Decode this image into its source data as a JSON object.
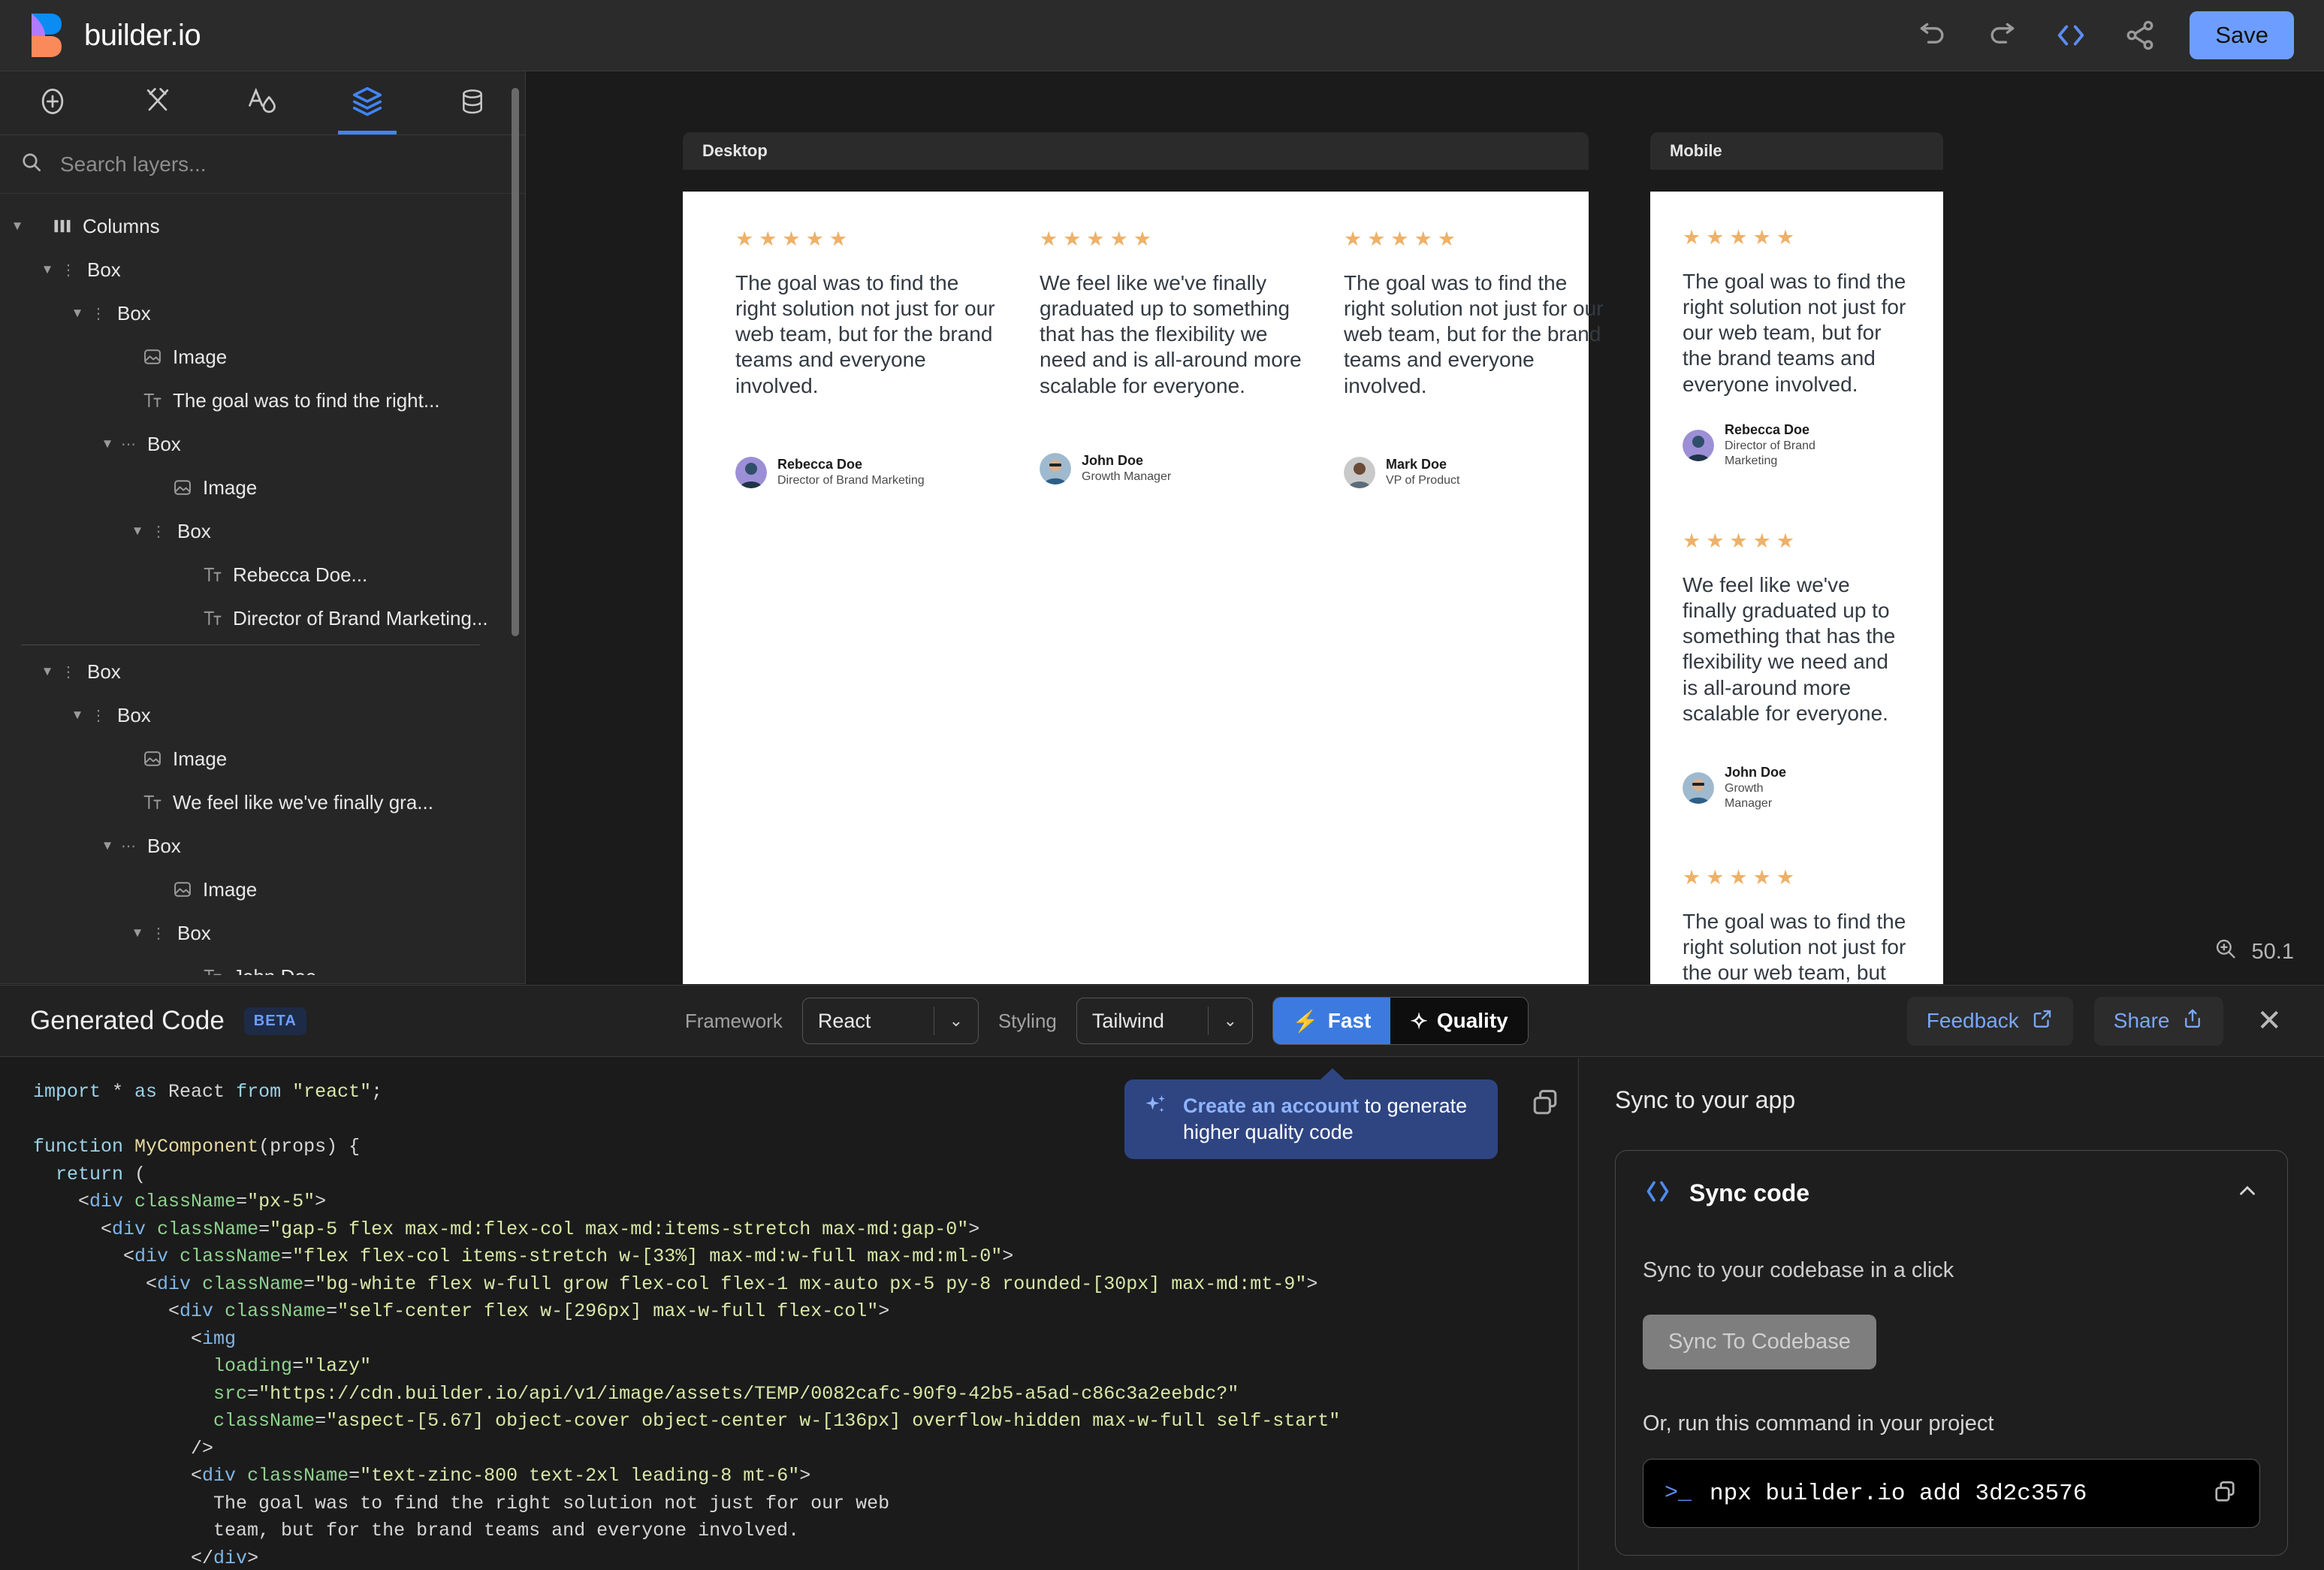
{
  "topbar": {
    "brand": "builder.io",
    "icons": [
      "undo-icon",
      "redo-icon",
      "code-brackets-icon",
      "share-icon"
    ],
    "save_label": "Save"
  },
  "left_panel": {
    "tabs": [
      {
        "name": "insert",
        "icon": "plus-circle-icon",
        "active": false
      },
      {
        "name": "design",
        "icon": "scissors-icon",
        "active": false
      },
      {
        "name": "theme",
        "icon": "text-style-icon",
        "active": false
      },
      {
        "name": "layers",
        "icon": "layers-icon",
        "active": true
      },
      {
        "name": "data",
        "icon": "database-icon",
        "active": false
      }
    ],
    "search_placeholder": "Search layers...",
    "tree": [
      {
        "indent": 0,
        "caret": "▼",
        "handle": "",
        "icon": "columns-icon",
        "label": "Columns"
      },
      {
        "indent": 1,
        "caret": "▼",
        "handle": "⋮",
        "icon": "",
        "label": "Box"
      },
      {
        "indent": 2,
        "caret": "▼",
        "handle": "⋮",
        "icon": "",
        "label": "Box"
      },
      {
        "indent": 3,
        "caret": "",
        "handle": "",
        "icon": "image-icon",
        "label": "Image"
      },
      {
        "indent": 3,
        "caret": "",
        "handle": "",
        "icon": "text-icon",
        "label": "The goal was to find the right..."
      },
      {
        "indent": 3,
        "caret": "▼",
        "handle": "⋯",
        "icon": "",
        "label": "Box"
      },
      {
        "indent": 4,
        "caret": "",
        "handle": "",
        "icon": "image-icon",
        "label": "Image"
      },
      {
        "indent": 4,
        "caret": "▼",
        "handle": "⋮",
        "icon": "",
        "label": "Box"
      },
      {
        "indent": 5,
        "caret": "",
        "handle": "",
        "icon": "text-icon",
        "label": "Rebecca Doe..."
      },
      {
        "indent": 5,
        "caret": "",
        "handle": "",
        "icon": "text-icon",
        "label": "Director of Brand Marketing..."
      },
      {
        "separator": true
      },
      {
        "indent": 1,
        "caret": "▼",
        "handle": "⋮",
        "icon": "",
        "label": "Box"
      },
      {
        "indent": 2,
        "caret": "▼",
        "handle": "⋮",
        "icon": "",
        "label": "Box"
      },
      {
        "indent": 3,
        "caret": "",
        "handle": "",
        "icon": "image-icon",
        "label": "Image"
      },
      {
        "indent": 3,
        "caret": "",
        "handle": "",
        "icon": "text-icon",
        "label": "We feel like we've finally gra..."
      },
      {
        "indent": 3,
        "caret": "▼",
        "handle": "⋯",
        "icon": "",
        "label": "Box"
      },
      {
        "indent": 4,
        "caret": "",
        "handle": "",
        "icon": "image-icon",
        "label": "Image"
      },
      {
        "indent": 4,
        "caret": "▼",
        "handle": "⋮",
        "icon": "",
        "label": "Box"
      },
      {
        "indent": 5,
        "caret": "",
        "handle": "",
        "icon": "text-icon",
        "label": "John Doe..."
      }
    ]
  },
  "canvas": {
    "desktop_label": "Desktop",
    "mobile_label": "Mobile",
    "zoom_value": "50.1",
    "stars": "★★★★★",
    "desktop_cards": [
      {
        "quote": "The goal was to find the right solution not just for our web team, but for the brand teams and everyone involved.",
        "name": "Rebecca Doe",
        "role": "Director of Brand Marketing"
      },
      {
        "quote": "We feel like we've finally graduated up to something that has the flexibility we need and is all-around more scalable for everyone.",
        "name": "John Doe",
        "role": "Growth Manager"
      },
      {
        "quote": "The goal was to find the right solution not just for our web team, but for the brand teams and everyone involved.",
        "name": "Mark Doe",
        "role": "VP of Product"
      }
    ],
    "mobile_cards": [
      {
        "quote": "The goal was to find the right solution not just for our web team, but for the brand teams and everyone involved.",
        "name": "Rebecca Doe",
        "role": "Director of Brand Marketing"
      },
      {
        "quote": "We feel like we've finally graduated up to something that has the flexibility we need and is all-around more scalable for everyone.",
        "name": "John Doe",
        "role": "Growth Manager"
      },
      {
        "quote": "The goal was to find the right solution not just for the\nour web team, but for the",
        "name": "",
        "role": ""
      }
    ]
  },
  "generated_code": {
    "title": "Generated Code",
    "badge": "BETA",
    "framework_label": "Framework",
    "framework_value": "React",
    "styling_label": "Styling",
    "styling_value": "Tailwind",
    "mode_fast": "Fast",
    "mode_quality": "Quality",
    "feedback_label": "Feedback",
    "share_label": "Share",
    "callout_bold": "Create an account",
    "callout_rest": " to generate higher quality code",
    "code_lines": [
      "import * as React from \"react\";",
      "",
      "function MyComponent(props) {",
      "  return (",
      "    <div className=\"px-5\">",
      "      <div className=\"gap-5 flex max-md:flex-col max-md:items-stretch max-md:gap-0\">",
      "        <div className=\"flex flex-col items-stretch w-[33%] max-md:w-full max-md:ml-0\">",
      "          <div className=\"bg-white flex w-full grow flex-col flex-1 mx-auto px-5 py-8 rounded-[30px] max-md:mt-9\">",
      "            <div className=\"self-center flex w-[296px] max-w-full flex-col\">",
      "              <img",
      "                loading=\"lazy\"",
      "                src=\"https://cdn.builder.io/api/v1/image/assets/TEMP/0082cafc-90f9-42b5-a5ad-c86c3a2eebdc?\"",
      "                className=\"aspect-[5.67] object-cover object-center w-[136px] overflow-hidden max-w-full self-start\"",
      "              />",
      "              <div className=\"text-zinc-800 text-2xl leading-8 mt-6\">",
      "                The goal was to find the right solution not just for our web",
      "                team, but for the brand teams and everyone involved.",
      "              </div>"
    ]
  },
  "sync_panel": {
    "heading": "Sync to your app",
    "card_title": "Sync code",
    "card_icon": "code-brackets-icon",
    "collapse_icon": "chevron-up-icon",
    "subtitle": "Sync to your codebase in a click",
    "button_label": "Sync To Codebase",
    "or_label": "Or, run this command in your project",
    "terminal_prompt": ">_",
    "terminal_command": "npx builder.io add 3d2c3576"
  },
  "colors": {
    "accent": "#4285f4",
    "save": "#6d9eff",
    "star": "#edb169",
    "callout_bg": "#2e4582"
  }
}
